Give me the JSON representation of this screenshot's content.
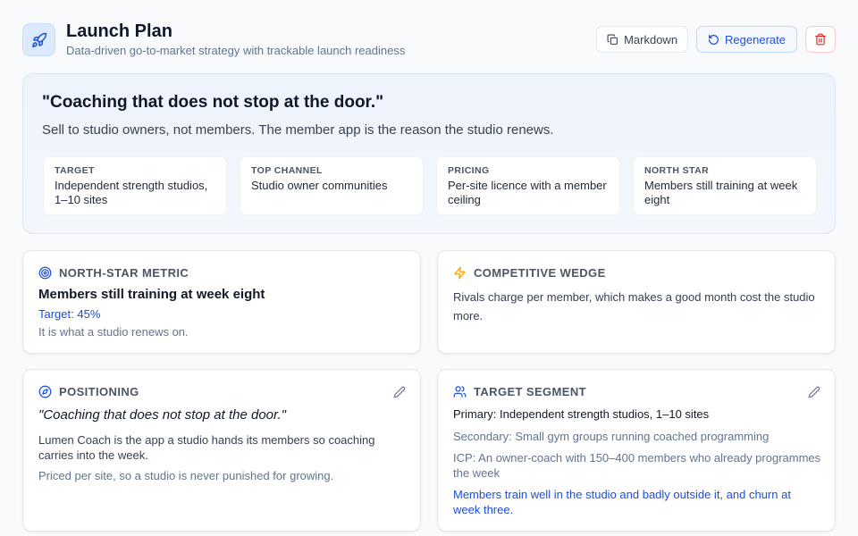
{
  "header": {
    "title": "Launch Plan",
    "subtitle": "Data-driven go-to-market strategy with trackable launch readiness",
    "icon": "rocket-icon",
    "actions": {
      "markdown_label": "Markdown",
      "regenerate_label": "Regenerate"
    }
  },
  "hero": {
    "quote": "\"Coaching that does not stop at the door.\"",
    "subline": "Sell to studio owners, not members. The member app is the reason the studio renews.",
    "cards": [
      {
        "label": "TARGET",
        "value": "Independent strength studios, 1–10 sites"
      },
      {
        "label": "TOP CHANNEL",
        "value": "Studio owner communities"
      },
      {
        "label": "PRICING",
        "value": "Per-site licence with a member ceiling"
      },
      {
        "label": "NORTH STAR",
        "value": "Members still training at week eight"
      }
    ]
  },
  "north_star": {
    "label": "NORTH-STAR METRIC",
    "metric": "Members still training at week eight",
    "target": "Target: 45%",
    "note": "It is what a studio renews on."
  },
  "wedge": {
    "label": "COMPETITIVE WEDGE",
    "text": "Rivals charge per member, which makes a good month cost the studio more."
  },
  "positioning": {
    "label": "POSITIONING",
    "quote": "\"Coaching that does not stop at the door.\"",
    "body": "Lumen Coach is the app a studio hands its members so coaching carries into the week.",
    "note": "Priced per site, so a studio is never punished for growing."
  },
  "segment": {
    "label": "TARGET SEGMENT",
    "primary": "Primary: Independent strength studios, 1–10 sites",
    "secondary": "Secondary: Small gym groups running coached programming",
    "icp": "ICP: An owner-coach with 150–400 members who already programmes the week",
    "pain": "Members train well in the studio and badly outside it, and churn at week three."
  },
  "colors": {
    "accent": "#1d4ed8",
    "danger": "#dc2626",
    "wedge": "#f59e0b"
  }
}
